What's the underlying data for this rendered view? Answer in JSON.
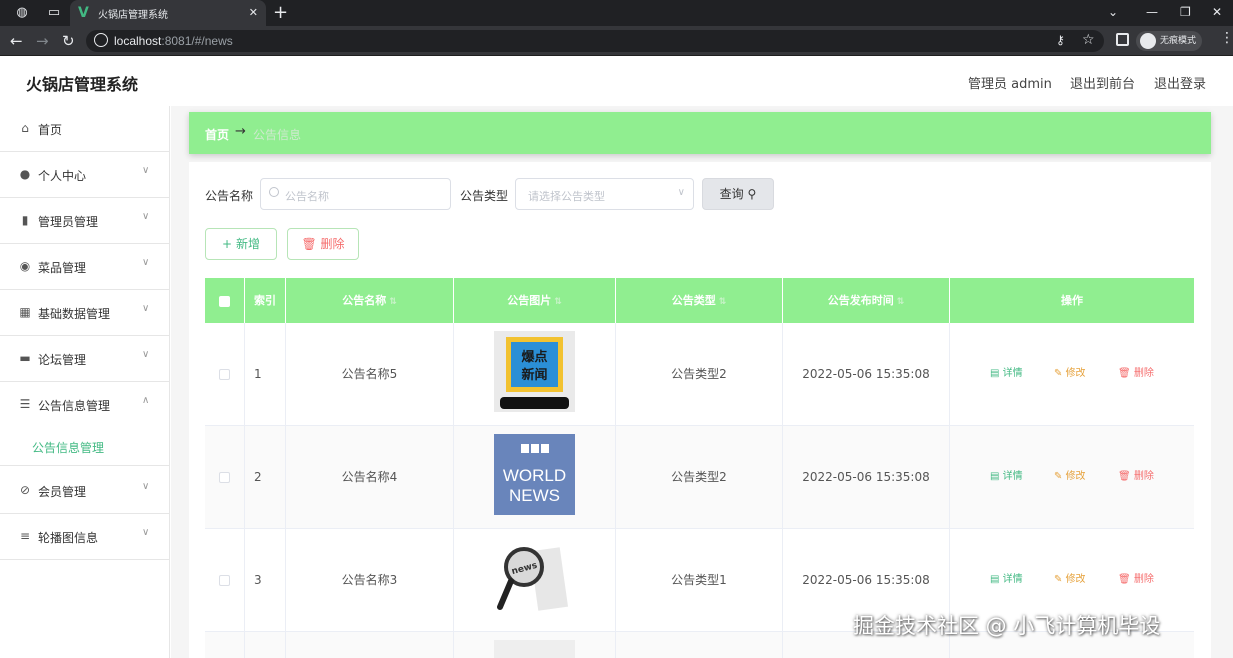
{
  "browser": {
    "tab_title": "火锅店管理系统",
    "tab_close": "✕",
    "new_tab": "+",
    "url_host": "localhost",
    "url_rest": ":8081/#/news",
    "incognito_label": "无痕模式"
  },
  "header": {
    "title": "火锅店管理系统",
    "admin_label": "管理员 admin",
    "front_link": "退出到前台",
    "logout_link": "退出登录"
  },
  "sidebar": {
    "items": [
      {
        "label": "首页",
        "icon": "home-icon"
      },
      {
        "label": "个人中心",
        "icon": "user-icon"
      },
      {
        "label": "管理员管理",
        "icon": "bar-chart-icon"
      },
      {
        "label": "菜品管理",
        "icon": "location-icon"
      },
      {
        "label": "基础数据管理",
        "icon": "grid-icon"
      },
      {
        "label": "论坛管理",
        "icon": "stack-icon"
      },
      {
        "label": "公告信息管理",
        "icon": "sliders-icon"
      },
      {
        "label": "会员管理",
        "icon": "leaf-icon"
      },
      {
        "label": "轮播图信息",
        "icon": "list-icon"
      }
    ],
    "active_sub": "公告信息管理"
  },
  "breadcrumb": {
    "home": "首页",
    "sep": "→",
    "current": "公告信息"
  },
  "filters": {
    "name_label": "公告名称",
    "name_placeholder": "公告名称",
    "type_label": "公告类型",
    "type_placeholder": "请选择公告类型",
    "query_button": "查询"
  },
  "actions": {
    "add": "新增",
    "delete": "删除"
  },
  "table": {
    "headers": [
      "索引",
      "公告名称",
      "公告图片",
      "公告类型",
      "公告发布时间",
      "操作"
    ],
    "rows": [
      {
        "index": "1",
        "name": "公告名称5",
        "type": "公告类型2",
        "time": "2022-05-06 15:35:08",
        "image_text": "爆点\n新闻"
      },
      {
        "index": "2",
        "name": "公告名称4",
        "type": "公告类型2",
        "time": "2022-05-06 15:35:08",
        "image_text": "BBC WORLD NEWS"
      },
      {
        "index": "3",
        "name": "公告名称3",
        "type": "公告类型1",
        "time": "2022-05-06 15:35:08",
        "image_text": "news"
      }
    ],
    "op_detail": "详情",
    "op_edit": "修改",
    "op_delete": "删除"
  },
  "watermark": "掘金技术社区 @ 小飞计算机毕设",
  "colors": {
    "accent_green": "#90ee90",
    "text_green": "#42b983",
    "warning": "#e6a23c",
    "danger": "#f56c6c"
  }
}
